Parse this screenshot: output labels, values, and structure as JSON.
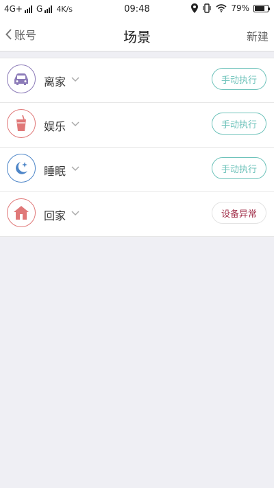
{
  "status_bar": {
    "network1": "4G+",
    "network2": "G",
    "speed": "4K/s",
    "time": "09:48",
    "battery": "79%",
    "battery_level": 0.79
  },
  "nav": {
    "back_label": "账号",
    "title": "场景",
    "right_label": "新建"
  },
  "colors": {
    "teal": "#6fc3bb",
    "error_text": "#a3344e",
    "purple": "#8c7bb8",
    "red": "#e07878",
    "blue": "#4e86c8"
  },
  "scenes": [
    {
      "name": "离家",
      "icon": "car-icon",
      "action": "手动执行"
    },
    {
      "name": "娱乐",
      "icon": "drink-icon",
      "action": "手动执行"
    },
    {
      "name": "睡眠",
      "icon": "moon-icon",
      "action": "手动执行"
    },
    {
      "name": "回家",
      "icon": "home-icon",
      "action": "设备异常"
    }
  ]
}
